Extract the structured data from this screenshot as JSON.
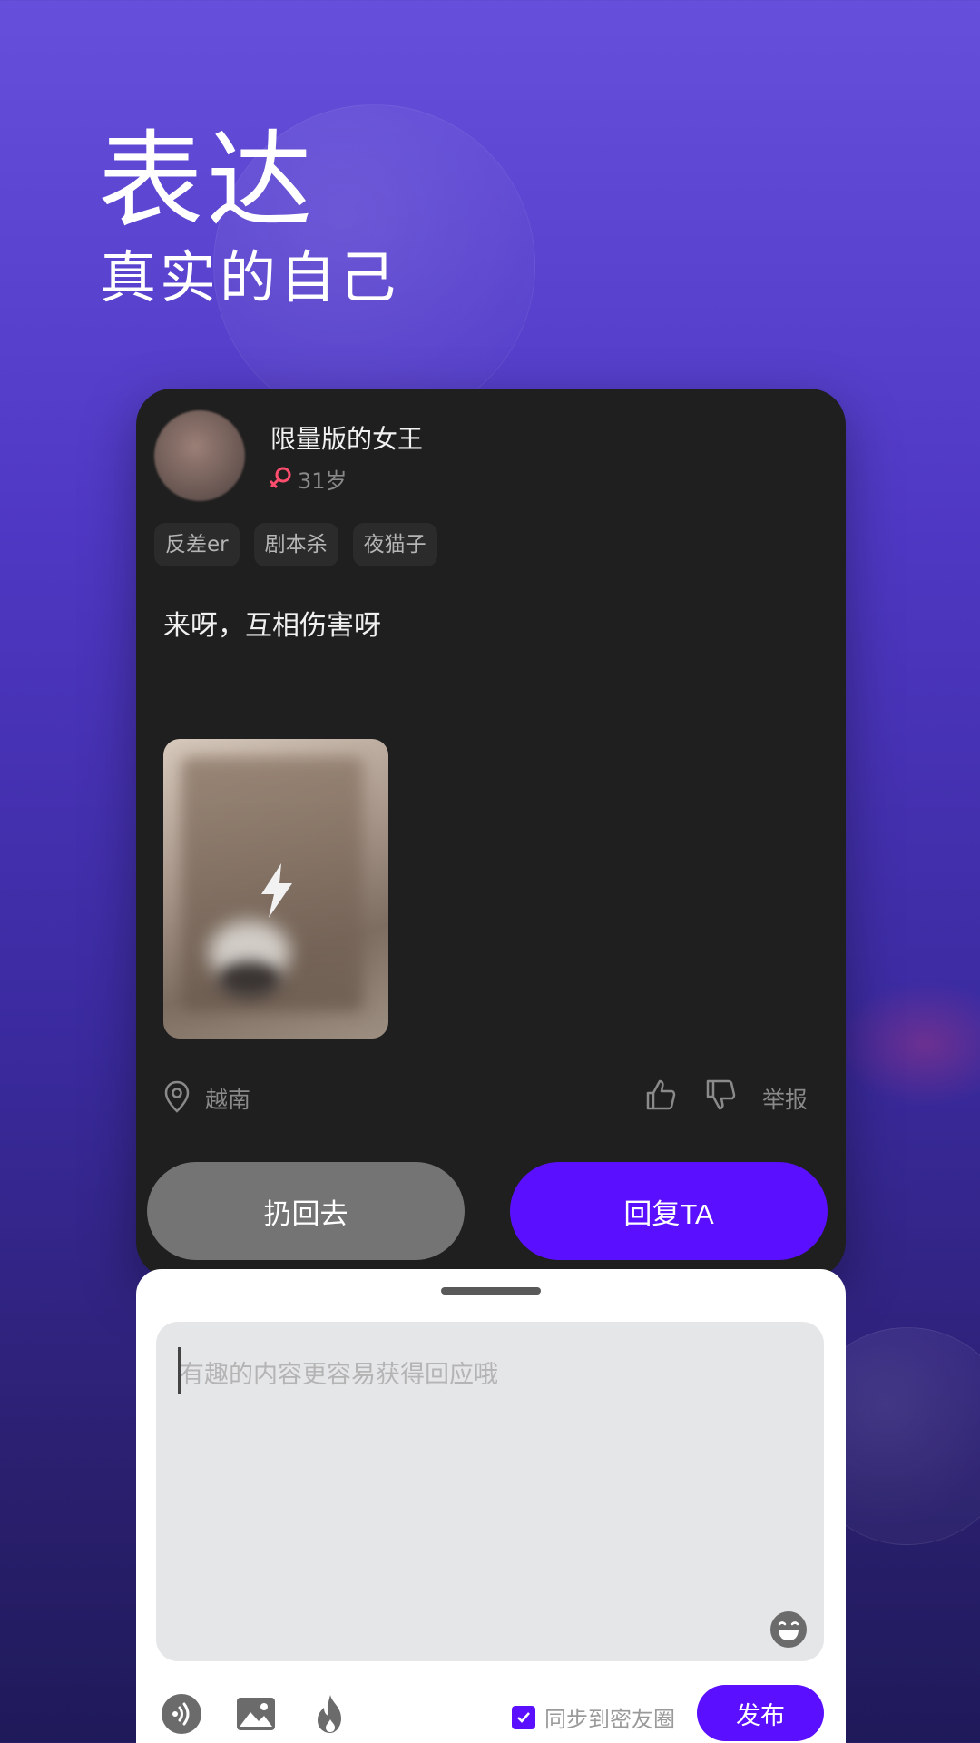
{
  "hero": {
    "title": "表达",
    "subtitle": "真实的自己"
  },
  "post": {
    "username": "限量版的女王",
    "age": "31岁",
    "gender_icon": "female-icon",
    "tags": [
      "反差er",
      "剧本杀",
      "夜猫子"
    ],
    "text": "来呀，互相伤害呀",
    "location": "越南",
    "report_label": "举报"
  },
  "actions": {
    "throw_back_label": "扔回去",
    "reply_label": "回复TA"
  },
  "composer": {
    "placeholder": "有趣的内容更容易获得回应哦",
    "sync_label": "同步到密友圈",
    "sync_checked": true,
    "publish_label": "发布"
  },
  "colors": {
    "accent": "#5a10ff",
    "card_bg": "#1f1f1f",
    "throw_button": "#747474",
    "gender_female": "#ff4d6d"
  }
}
